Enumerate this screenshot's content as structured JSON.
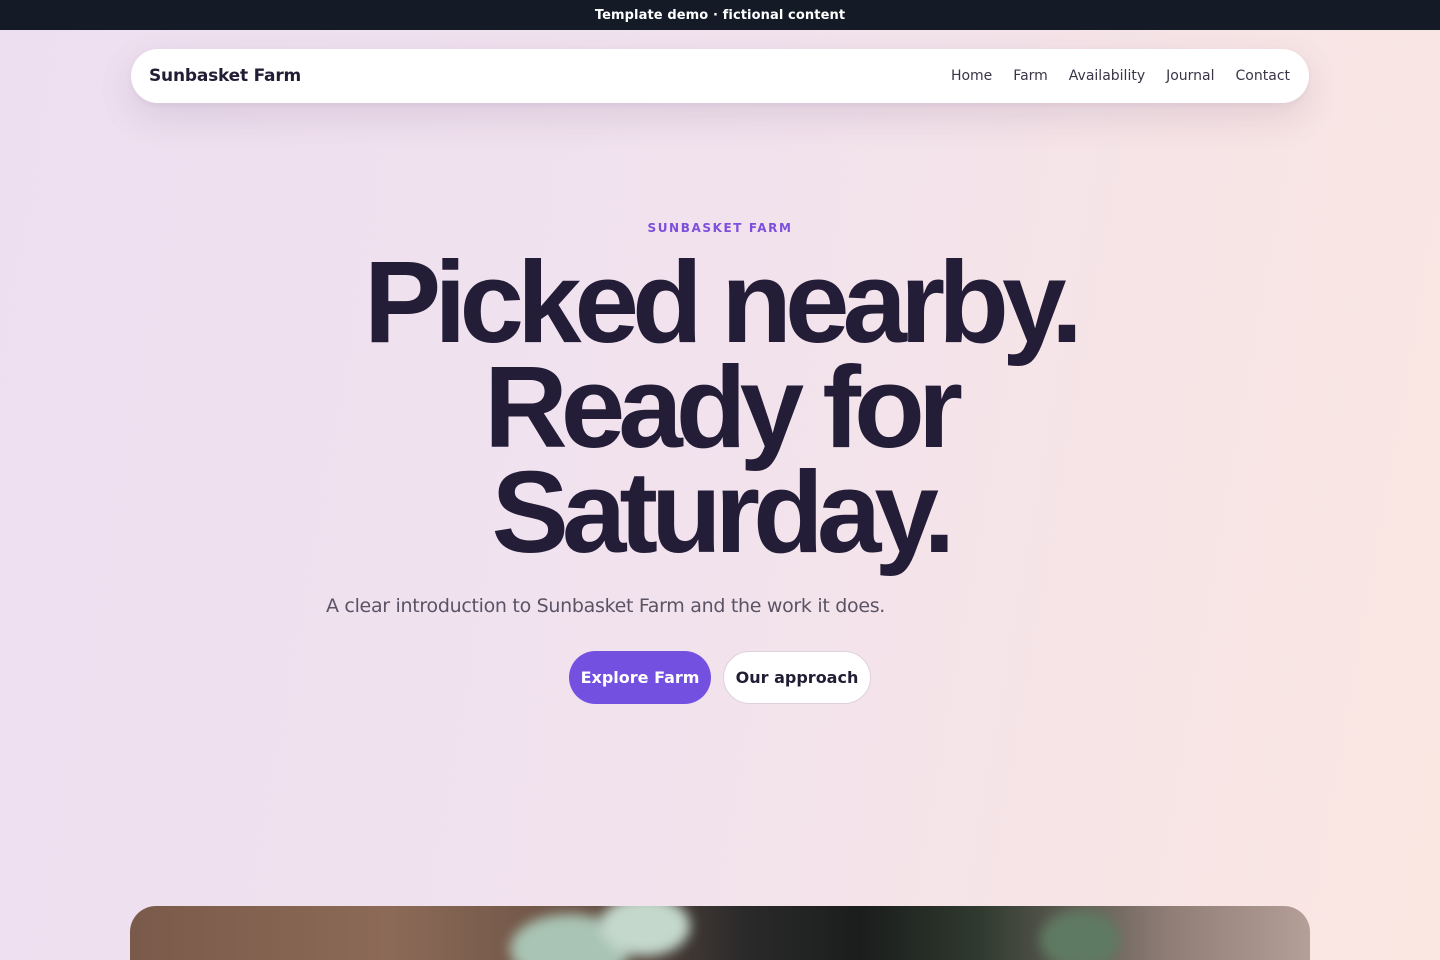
{
  "banner": {
    "text": "Template demo · fictional content"
  },
  "nav": {
    "brand": "Sunbasket Farm",
    "links": [
      "Home",
      "Farm",
      "Availability",
      "Journal",
      "Contact"
    ]
  },
  "hero": {
    "eyebrow": "SUNBASKET FARM",
    "headline_lines": [
      "Picked nearby.",
      "Ready for",
      "Saturday."
    ],
    "subtitle": "A clear introduction to Sunbasket Farm and the work it does.",
    "primary_button": "Explore Farm",
    "secondary_button": "Our approach"
  },
  "colors": {
    "accent": "#7450e0",
    "eyebrow": "#7d4fdc",
    "text_dark": "#241d38",
    "topbar": "#141a26"
  }
}
